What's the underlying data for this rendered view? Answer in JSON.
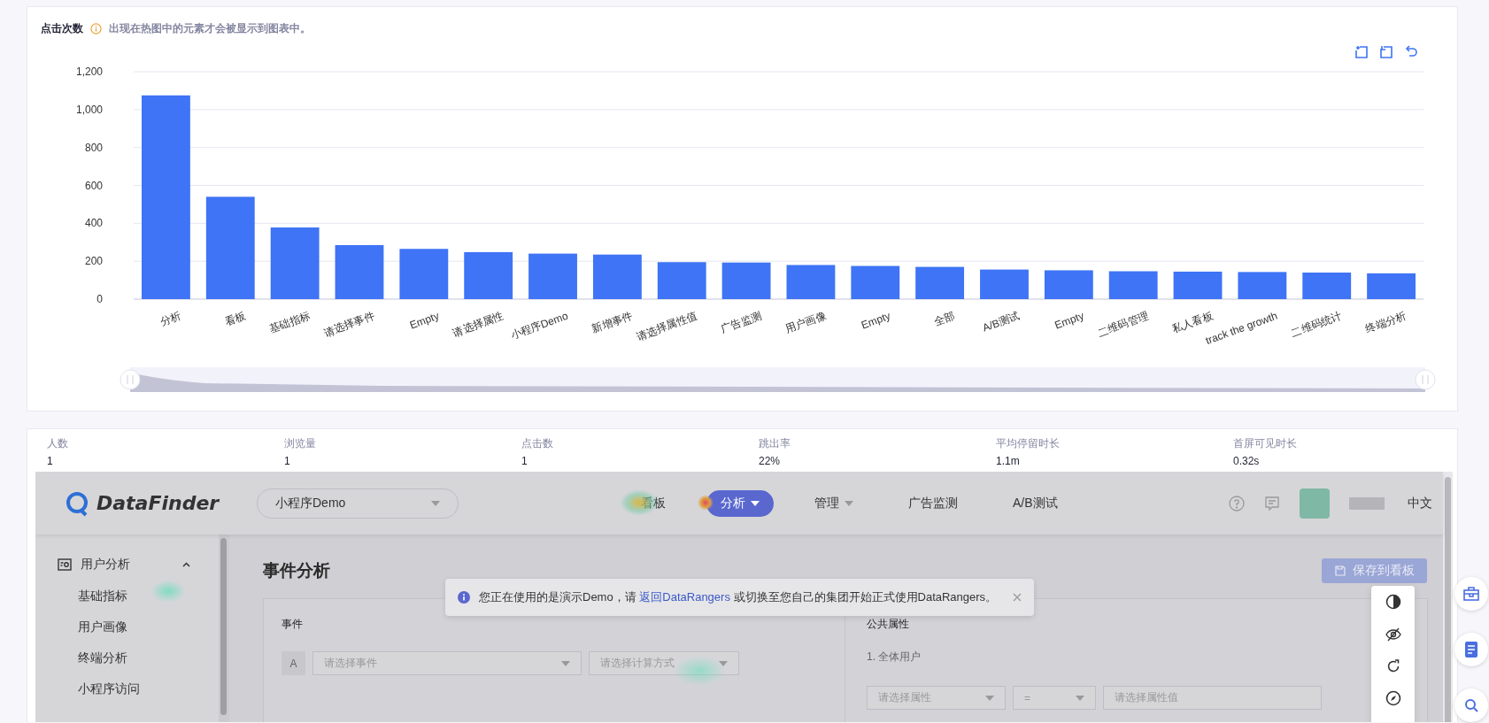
{
  "chart_panel": {
    "hint": "出现在热图中的元素才会被显示到图表中。",
    "chart_data": {
      "type": "bar",
      "title": "点击次数",
      "categories": [
        "分析",
        "看板",
        "基础指标",
        "请选择事件",
        "Empty",
        "请选择属性",
        "小程序Demo",
        "新增事件",
        "请选择属性值",
        "广告监测",
        "用户画像",
        "Empty",
        "全部",
        "A/B测试",
        "Empty",
        "二维码管理",
        "私人看板",
        "track the growth",
        "二维码统计",
        "终端分析"
      ],
      "series": [
        {
          "color": "#3e74f5",
          "values": [
            1075,
            540,
            378,
            285,
            265,
            248,
            240,
            235,
            195,
            193,
            180,
            175,
            170,
            156,
            152,
            147,
            145,
            143,
            140,
            136
          ]
        }
      ],
      "ylim": [
        0,
        1200
      ],
      "grid": true,
      "yticks": [
        {
          "value": 0,
          "label": "0"
        },
        {
          "value": 200,
          "label": "200"
        },
        {
          "value": 400,
          "label": "400"
        },
        {
          "value": 600,
          "label": "600"
        },
        {
          "value": 800,
          "label": "800"
        },
        {
          "value": 1000,
          "label": "1,000"
        },
        {
          "value": 1200,
          "label": "1,200"
        }
      ]
    }
  },
  "stats": [
    {
      "label": "人数",
      "value": "1"
    },
    {
      "label": "浏览量",
      "value": "1"
    },
    {
      "label": "点击数",
      "value": "1"
    },
    {
      "label": "跳出率",
      "value": "22%"
    },
    {
      "label": "平均停留时长",
      "value": "1.1m"
    },
    {
      "label": "首屏可见时长",
      "value": "0.32s"
    }
  ],
  "app_preview": {
    "logo": "DataFinder",
    "project": "小程序Demo",
    "nav": [
      {
        "label": "看板",
        "selected": false,
        "dropdown": false
      },
      {
        "label": "分析",
        "selected": true,
        "dropdown": true
      },
      {
        "label": "管理",
        "selected": false,
        "dropdown": true
      },
      {
        "label": "广告监测",
        "selected": false,
        "dropdown": false
      },
      {
        "label": "A/B测试",
        "selected": false,
        "dropdown": false
      }
    ],
    "language": "中文",
    "sidebar": [
      {
        "label": "用户分析",
        "expanded": true,
        "children": [
          {
            "label": "基础指标"
          },
          {
            "label": "用户画像"
          },
          {
            "label": "终端分析"
          },
          {
            "label": "小程序访问"
          }
        ]
      }
    ],
    "page_title": "事件分析",
    "notice": {
      "text_before": "您正在使用的是演示Demo，请 ",
      "link": "返回DataRangers",
      "text_after": " 或切换至您自己的集团开始正式使用DataRangers。"
    },
    "save_button": "保存到看板",
    "event_section": {
      "label": "事件",
      "badge": "A",
      "event_placeholder": "请选择事件",
      "method_placeholder": "请选择计算方式"
    },
    "attribute_section": {
      "label": "公共属性",
      "group": "1. 全体用户",
      "property_placeholder": "请选择属性",
      "operator": "=",
      "value_placeholder": "请选择属性值"
    }
  }
}
